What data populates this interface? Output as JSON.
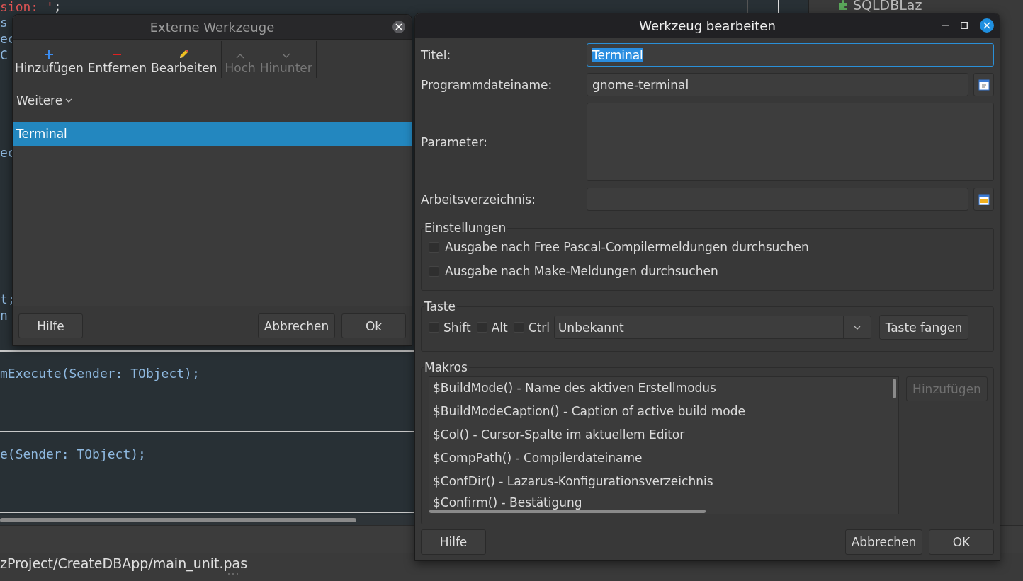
{
  "editor": {
    "lines": [
      {
        "parts": [
          {
            "text": "sion: '",
            "kind": "string"
          },
          {
            "text": ";",
            "kind": "symbol"
          }
        ]
      },
      {
        "parts": [
          {
            "text": "s",
            "kind": "identifier"
          }
        ]
      },
      {
        "parts": [
          {
            "text": "ec",
            "kind": "identifier"
          }
        ]
      },
      {
        "parts": [
          {
            "text": "C",
            "kind": "identifier"
          }
        ]
      },
      {
        "parts": [
          {
            "text": "ec",
            "kind": "identifier"
          }
        ]
      },
      {
        "parts": [
          {
            "text": "t;",
            "kind": "identifier"
          }
        ]
      },
      {
        "parts": [
          {
            "text": "n",
            "kind": "identifier"
          }
        ]
      }
    ],
    "lower_panes": [
      {
        "text": "mExecute(Sender: TObject);"
      },
      {
        "text": "e(Sender: TObject);"
      }
    ]
  },
  "project_tree": {
    "item": "SQLDBLaz"
  },
  "status_bar": {
    "path": "zProject/CreateDBApp/main_unit.pas"
  },
  "tools_dialog": {
    "title": "Externe Werkzeuge",
    "active": false,
    "toolbar": [
      {
        "kind": "add",
        "label": "Hinzufügen",
        "disabled": false
      },
      {
        "kind": "remove",
        "label": "Entfernen",
        "disabled": false
      },
      {
        "kind": "edit",
        "label": "Bearbeiten",
        "disabled": false
      },
      {
        "kind": "up",
        "label": "Hoch",
        "disabled": true
      },
      {
        "kind": "down",
        "label": "Hinunter",
        "disabled": true
      }
    ],
    "more_menu": "Weitere",
    "tools": [
      {
        "label": "Terminal",
        "selected": true
      }
    ],
    "buttons": [
      {
        "label": "Hilfe"
      },
      {
        "label": "Abbrechen"
      },
      {
        "label": "Ok"
      }
    ]
  },
  "edit_dialog": {
    "title": "Werkzeug bearbeiten",
    "active": true,
    "fields": [
      {
        "label": "Titel:",
        "kind": "text",
        "value": "Terminal",
        "focused": true
      },
      {
        "label": "Programmdateiname:",
        "kind": "file",
        "value": "gnome-terminal",
        "focused": false
      },
      {
        "label": "Parameter:",
        "kind": "multiline",
        "focused": false
      },
      {
        "label": "Arbeitsverzeichnis:",
        "kind": "directory",
        "focused": false
      }
    ],
    "settings": {
      "title": "Einstellungen",
      "options": [
        {
          "label": "Ausgabe nach Free Pascal-Compilermeldungen durchsuchen",
          "checked": false
        },
        {
          "label": "Ausgabe nach Make-Meldungen durchsuchen",
          "checked": false
        }
      ]
    },
    "hotkey": {
      "title": "Taste",
      "modifiers": [
        {
          "label": "Shift",
          "checked": false
        },
        {
          "label": "Alt",
          "checked": false
        },
        {
          "label": "Ctrl",
          "checked": false
        }
      ],
      "key": "Unbekannt",
      "capture_button": "Taste fangen"
    },
    "macros": {
      "title": "Makros",
      "items": [
        {
          "label": "$BuildMode() - Name des aktiven Erstellmodus"
        },
        {
          "label": "$BuildModeCaption() - Caption of active build mode"
        },
        {
          "label": "$Col() - Cursor-Spalte im aktuellem Editor"
        },
        {
          "label": "$CompPath() - Compilerdateiname"
        },
        {
          "label": "$ConfDir() - Lazarus-Konfigurationsverzeichnis"
        },
        {
          "label": "$Confirm() - Bestätigung"
        }
      ],
      "add_button": {
        "label": "Hinzufügen",
        "disabled": true
      }
    },
    "buttons": [
      {
        "label": "Hilfe"
      },
      {
        "label": "Abbrechen"
      },
      {
        "label": "OK"
      }
    ]
  }
}
